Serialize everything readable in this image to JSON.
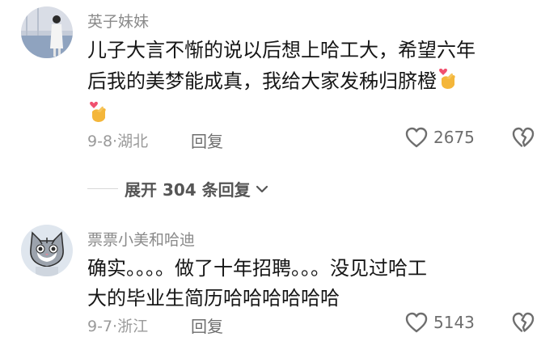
{
  "comments": [
    {
      "username": "英子妹妹",
      "lines": [
        "儿子大言不惭的说以后想上哈工大，希望六年",
        "后我的美梦能成真，我给大家发秭归脐橙"
      ],
      "emoji": "finger-heart-emoji",
      "date": "9-8",
      "location": "湖北",
      "reply_label": "回复",
      "likes": "2675",
      "expand_label": "展开 304 条回复"
    },
    {
      "username": "票票小美和哈迪",
      "lines": [
        "确实。。。。做了十年招聘。。。没见过哈工",
        "大的毕业生简历哈哈哈哈哈哈"
      ],
      "date": "9-7",
      "location": "浙江",
      "reply_label": "回复",
      "likes": "5143"
    }
  ],
  "icons": {
    "like": "heart-outline-icon",
    "dislike": "broken-heart-icon",
    "expand": "chevron-down-icon"
  },
  "colors": {
    "text": "#161616",
    "username": "#8a8a8a",
    "meta": "#9a9a9a",
    "emoji_hand": "#f4b63a",
    "emoji_heart": "#f0506e"
  }
}
